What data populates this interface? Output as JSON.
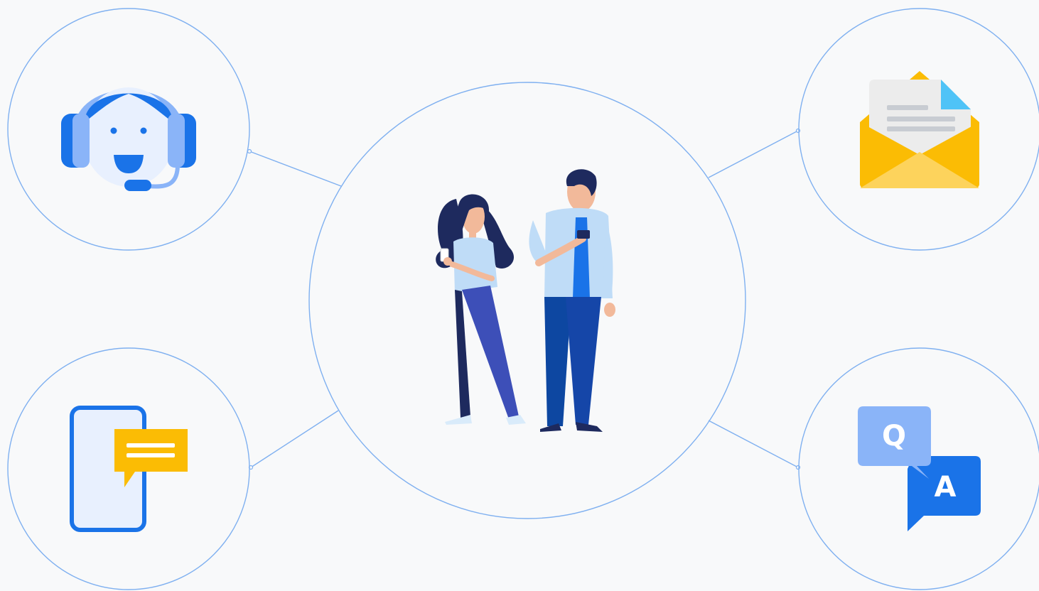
{
  "diagram": {
    "center": {
      "icon": "two-people-with-phones-illustration"
    },
    "nodes": [
      {
        "id": "support",
        "icon": "headset-agent-icon"
      },
      {
        "id": "email",
        "icon": "open-envelope-letter-icon"
      },
      {
        "id": "chat",
        "icon": "phone-chat-bubble-icon"
      },
      {
        "id": "faq",
        "icon": "question-answer-bubbles-icon",
        "q_letter": "Q",
        "a_letter": "A"
      }
    ],
    "colors": {
      "background": "#f8f9fa",
      "outline": "#7fb0f0",
      "primary_blue": "#1a73e8",
      "light_blue": "#8ab4f8",
      "pale_blue": "#e8f0fe",
      "yellow": "#fbbc04",
      "navy": "#1e2a5e",
      "skin": "#f2b99a"
    }
  }
}
